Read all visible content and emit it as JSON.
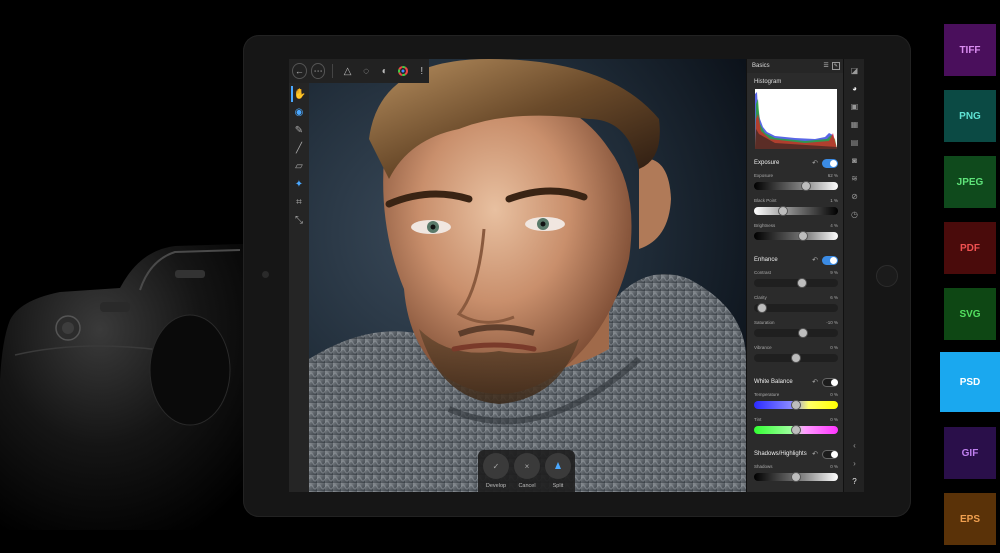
{
  "topbar": {
    "back_icon": "back-arrow-icon",
    "more_icon": "more-icon",
    "tools": [
      "mask-icon",
      "lasso-icon",
      "tone-icon",
      "color-wheel-icon",
      "info-icon"
    ]
  },
  "left_tools": [
    "hand-icon",
    "eye-icon",
    "eyedropper-icon",
    "brush-icon",
    "eraser-icon",
    "magic-wand-icon",
    "crop-icon",
    "select-icon"
  ],
  "bottom_bar": {
    "develop_label": "Develop",
    "cancel_label": "Cancel",
    "split_label": "Split",
    "develop_glyph": "✓",
    "cancel_glyph": "×"
  },
  "panel": {
    "tab_label": "Basics",
    "histogram_title": "Histogram",
    "exposure": {
      "title": "Exposure",
      "enabled": true,
      "rows": [
        {
          "label": "Exposure",
          "value": "62 %",
          "level": 0.62
        },
        {
          "label": "Black Point",
          "value": "1 %",
          "level": 0.34
        },
        {
          "label": "Brightness",
          "value": "4 %",
          "level": 0.58
        }
      ]
    },
    "enhance": {
      "title": "Enhance",
      "enabled": true,
      "rows": [
        {
          "label": "Contrast",
          "value": "9 %",
          "level": 0.57
        },
        {
          "label": "Clarity",
          "value": "6 %",
          "level": 0.1
        },
        {
          "label": "Saturation",
          "value": "-10 %",
          "level": 0.58
        },
        {
          "label": "Vibrance",
          "value": "0 %",
          "level": 0.5
        }
      ]
    },
    "white_balance": {
      "title": "White Balance",
      "enabled": false,
      "rows": [
        {
          "label": "Temperature",
          "value": "0 %",
          "level": 0.5
        },
        {
          "label": "Tint",
          "value": "0 %",
          "level": 0.5
        }
      ]
    },
    "shadows_highlights": {
      "title": "Shadows/Highlights",
      "enabled": false,
      "rows": [
        {
          "label": "Shadows",
          "value": "0 %",
          "level": 0.5
        }
      ]
    }
  },
  "studio_icons": [
    "histogram-studio-icon",
    "color-studio-icon",
    "transform-studio-icon",
    "brush-studio-icon",
    "adjustments-studio-icon",
    "camera-studio-icon",
    "layers-studio-icon",
    "navigator-studio-icon",
    "history-studio-icon",
    "chevron-left-icon",
    "chevron-right-icon",
    "help-icon"
  ],
  "help_glyph": "?",
  "formats": [
    {
      "label": "TIFF",
      "bg": "#4a0f5c",
      "fg": "#d98cf0"
    },
    {
      "label": "PNG",
      "bg": "#0b4a44",
      "fg": "#5fe3d4"
    },
    {
      "label": "JPEG",
      "bg": "#0f4a1c",
      "fg": "#5fe37a"
    },
    {
      "label": "PDF",
      "bg": "#4a0b0b",
      "fg": "#f05050"
    },
    {
      "label": "SVG",
      "bg": "#0e4714",
      "fg": "#53e060"
    },
    {
      "label": "PSD",
      "bg": "#1aa8ef",
      "fg": "#ffffff"
    },
    {
      "label": "GIF",
      "bg": "#2a0f4a",
      "fg": "#c080f0"
    },
    {
      "label": "EPS",
      "bg": "#5a3208",
      "fg": "#f0a050"
    }
  ],
  "colors": {
    "accent": "#3b8be4",
    "panel_bg": "#2b2b2b",
    "tablet_bg": "#161616"
  }
}
